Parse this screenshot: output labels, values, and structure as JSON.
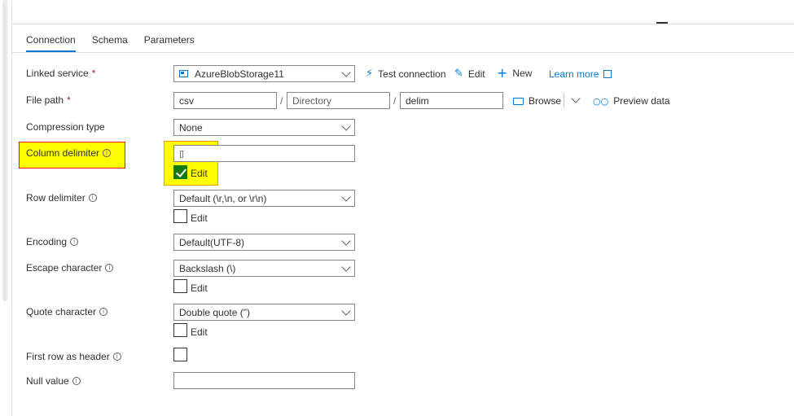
{
  "tabs": [
    {
      "label": "Connection",
      "active": true
    },
    {
      "label": "Schema",
      "active": false
    },
    {
      "label": "Parameters",
      "active": false
    }
  ],
  "linked_service": {
    "label": "Linked service",
    "required_mark": "*",
    "value": "AzureBlobStorage11",
    "test_connection": "Test connection",
    "edit": "Edit",
    "new": "New",
    "learn_more": "Learn more"
  },
  "file_path": {
    "label": "File path",
    "required_mark": "*",
    "container": "csv",
    "directory_placeholder": "Directory",
    "file": "delim",
    "separator": "/",
    "browse": "Browse",
    "preview": "Preview data"
  },
  "compression_type": {
    "label": "Compression type",
    "value": "None"
  },
  "column_delimiter": {
    "label": "Column delimiter",
    "value": "▯",
    "edit_label": "Edit",
    "edit_checked": true
  },
  "row_delimiter": {
    "label": "Row delimiter",
    "value": "Default (\\r,\\n, or \\r\\n)",
    "edit_label": "Edit",
    "edit_checked": false
  },
  "encoding": {
    "label": "Encoding",
    "value": "Default(UTF-8)"
  },
  "escape_character": {
    "label": "Escape character",
    "value": "Backslash (\\)",
    "edit_label": "Edit",
    "edit_checked": false
  },
  "quote_character": {
    "label": "Quote character",
    "value": "Double quote (\")",
    "edit_label": "Edit",
    "edit_checked": false
  },
  "first_row_header": {
    "label": "First row as header",
    "checked": false
  },
  "null_value": {
    "label": "Null value",
    "value": ""
  },
  "info_glyph": "i",
  "colors": {
    "accent": "#0078d4",
    "highlight": "#ffff00",
    "checked": "#107c10",
    "required": "#a4262c"
  }
}
